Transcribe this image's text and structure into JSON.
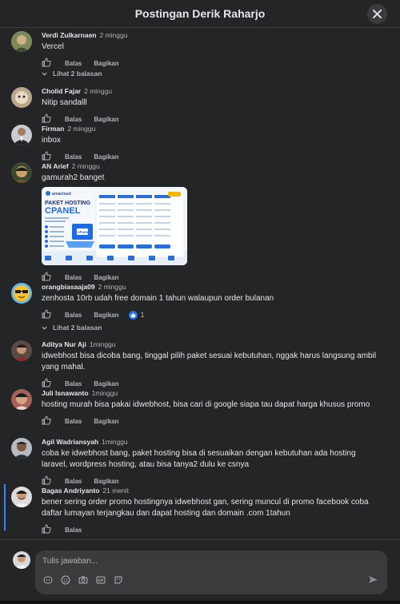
{
  "dialog": {
    "title": "Postingan Derik Raharjo",
    "close_icon": "close-icon"
  },
  "actions": {
    "like": "like-icon",
    "reply": "Balas",
    "share": "Bagikan"
  },
  "comments": [
    {
      "author": "Verdi Zulkarnaen",
      "time": "2 minggu",
      "text": "Vercel",
      "more_replies": "Lihat 2 balasan"
    },
    {
      "author": "Cholid Fajar",
      "time": "2 minggu",
      "text": "Nitip sandalll"
    },
    {
      "author": "Firman",
      "time": "2 minggu",
      "text": "inbox"
    },
    {
      "author": "AN Arief",
      "time": "2 minggu",
      "text": "gamurah2 banget",
      "attachment": {
        "brand": "arvacloud",
        "headline": "PAKET HOSTING",
        "product": "CPANEL",
        "badge": "cPanel"
      }
    },
    {
      "author": "orangbiasaaja09",
      "time": "2 minggu",
      "text": "zenhosta 10rb udah free domain 1 tahun walaupun order bulanan",
      "reaction_count": "1",
      "more_replies": "Lihat 2 balasan"
    },
    {
      "author": "Aditya Nur Aji",
      "time": "1minggu",
      "text": "idwebhost bisa dicoba bang, tinggal pilih paket sesuai kebutuhan, nggak harus langsung ambil yang mahal."
    },
    {
      "author": "Juli Isnawanto",
      "time": "1minggu",
      "text": "hosting murah bisa pakai idwebhost, bisa cari di google siapa tau dapat harga khusus promo"
    },
    {
      "author": "Agil Wadriansyah",
      "time": "1minggu",
      "text": "coba ke idwebhost bang, paket hosting bisa di sesuaikan dengan kebutuhan ada hosting laravel, wordpress hosting, atau bisa tanya2 dulu ke csnya"
    },
    {
      "author": "Bagas Andriyanto",
      "time": "21 menit",
      "text": "bener sering order promo hostingnya idwebhost gan, sering muncul di promo facebook coba daftar lumayan terjangkau dan dapat hosting dan domain .com 1tahun"
    }
  ],
  "composer": {
    "placeholder": "Tulis jawaban...",
    "tools": [
      "sticker-icon",
      "emoji-icon",
      "camera-icon",
      "gif-icon",
      "avatar-sticker-icon"
    ],
    "send_icon": "send-icon"
  }
}
